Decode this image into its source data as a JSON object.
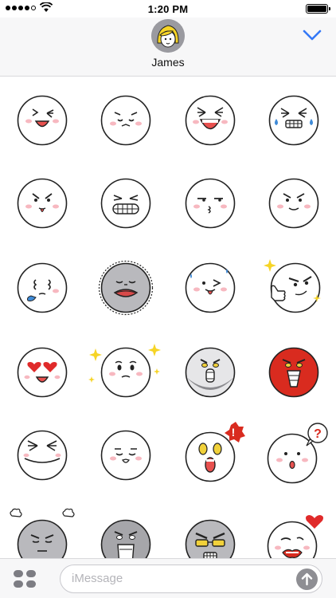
{
  "status_bar": {
    "time": "1:20 PM",
    "signal_icon": "signal-dots-icon",
    "wifi_icon": "wifi-icon",
    "battery_icon": "battery-icon",
    "battery_level": 1.0
  },
  "header": {
    "contact_name": "James",
    "avatar_icon": "avatar-icon",
    "collapse_icon": "chevron-down-icon",
    "accent_color": "#3478f6"
  },
  "stickers": [
    {
      "id": "laugh-wink"
    },
    {
      "id": "content-squint"
    },
    {
      "id": "big-laugh"
    },
    {
      "id": "crying-laugh"
    },
    {
      "id": "angry-tongue"
    },
    {
      "id": "gritted-teeth"
    },
    {
      "id": "smug-kiss"
    },
    {
      "id": "annoyed-smirk"
    },
    {
      "id": "drooling-sleepy"
    },
    {
      "id": "sick-grey"
    },
    {
      "id": "wink-tongue-sweat"
    },
    {
      "id": "thumbs-up-cool"
    },
    {
      "id": "heart-eyes"
    },
    {
      "id": "sparkle-moved"
    },
    {
      "id": "metallic-scream"
    },
    {
      "id": "red-angry-shout"
    },
    {
      "id": "wide-grin-closed-eyes"
    },
    {
      "id": "calm-blush"
    },
    {
      "id": "shock-exclamation"
    },
    {
      "id": "confused-question"
    },
    {
      "id": "steaming-grey"
    },
    {
      "id": "grey-scream"
    },
    {
      "id": "sunglasses-grey"
    },
    {
      "id": "heart-red-lips"
    }
  ],
  "input_bar": {
    "apps_icon": "app-drawer-icon",
    "placeholder": "iMessage",
    "send_icon": "send-arrow-icon"
  }
}
